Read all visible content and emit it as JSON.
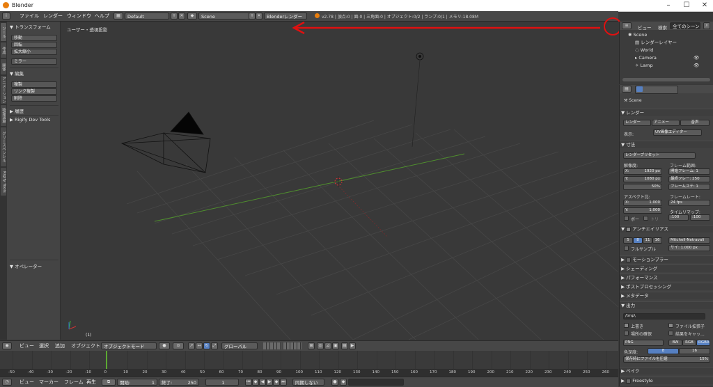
{
  "window": {
    "title": "Blender"
  },
  "top_menu": [
    "ファイル",
    "レンダー",
    "ウィンドウ",
    "ヘルプ"
  ],
  "screen_layout": "Default",
  "scene_name": "Scene",
  "render_engine": "Blenderレンダー",
  "status_text": "v2.78 | 頂点:0 | 面:0 | 三角面:0 | オブジェクト:0/2 | ランプ:0/1 | メモリ:18.08M",
  "viewport": {
    "view_label": "ユーザー・透視投影",
    "frame_label": "(1)"
  },
  "toolshelf_tabs": [
    "ツール",
    "作成",
    "関係",
    "アニメーション",
    "物理演算",
    "グリースペンシル",
    "Rigify Tools"
  ],
  "toolshelf": {
    "transform_header": "トランスフォーム",
    "transform_buttons": [
      "移動",
      "回転",
      "拡大縮小"
    ],
    "mirror_button": "ミラー",
    "edit_header": "編集",
    "edit_buttons": [
      "複製",
      "リンク複製",
      "削除"
    ],
    "history_header": "履歴",
    "rigify_header": "Rigify Dev Tools",
    "operator_header": "オペレーター"
  },
  "outliner": {
    "tabs": [
      "ビュー",
      "検索",
      "全てのシーン"
    ],
    "items": [
      "Scene",
      "レンダーレイヤー",
      "World",
      "Camera",
      "Lamp"
    ]
  },
  "properties": {
    "context": "Scene",
    "render_header": "レンダー",
    "render_buttons": [
      "レンダー",
      "アニメー",
      "音声"
    ],
    "display_label": "表示:",
    "display_value": "UV画像エディター",
    "dimensions_header": "寸法",
    "render_preset": "レンダープリセット",
    "resolution_label": "解像度:",
    "res_x": "X:",
    "res_x_value": "1920 px",
    "res_y": "Y:",
    "res_y_value": "1080 px",
    "res_percent": "50%",
    "frame_range_label": "フレーム範囲:",
    "frame_start": "開始フレーム: 1",
    "frame_end": "最終フレー: 250",
    "frame_step": "フレームステ: 1",
    "aspect_label": "アスペクト比:",
    "aspect_x": "X:",
    "aspect_x_value": "1.000",
    "aspect_y": "Y:",
    "aspect_y_value": "1.000",
    "framerate_label": "フレームレート:",
    "framerate_value": "24 fps",
    "time_remap_label": "タイムリマップ:",
    "remap_old": ":100",
    "remap_new": ":100",
    "border_label": "ボー",
    "crop_label": "トリ",
    "aa_header": "アンチエイリアス",
    "aa_samples": [
      "5",
      "8",
      "11",
      "16"
    ],
    "aa_filter": "Mitchell-Netravali",
    "full_sample": "フルサンプル",
    "size_value": "サイ: 1.000 px",
    "collapsed_panels": [
      "モーションブラー",
      "シェーディング",
      "パフォーマンス",
      "ポストプロセッシング",
      "メタデータ"
    ],
    "output_header": "出力",
    "output_path": "/tmp\\",
    "overwrite": "上書き",
    "file_ext": "ファイル拡張子",
    "placeholders": "場所の確保",
    "cache_result": "結果をキャッ...",
    "format": "PNG",
    "color_modes": [
      "BW",
      "RGB",
      "RGBA"
    ],
    "color_depth_label": "色深度:",
    "color_depth": [
      "8",
      "16"
    ],
    "compression": "保存時にファイルを圧縮",
    "compression_value": "15%",
    "bake_header": "ベイク",
    "freestyle_header": "Freestyle"
  },
  "view3d_header": {
    "menus": [
      "ビュー",
      "選択",
      "追加",
      "オブジェクト"
    ],
    "mode": "オブジェクトモード",
    "orientation": "グローバル"
  },
  "timeline": {
    "ticks": [
      "-50",
      "-40",
      "-30",
      "-20",
      "-10",
      "0",
      "10",
      "20",
      "30",
      "40",
      "50",
      "60",
      "70",
      "80",
      "90",
      "100",
      "110",
      "120",
      "130",
      "140",
      "150",
      "160",
      "170",
      "180",
      "190",
      "200",
      "210",
      "220",
      "230",
      "240",
      "250",
      "260"
    ],
    "menus": [
      "ビュー",
      "マーカー",
      "フレーム",
      "再生"
    ],
    "start_label": "開始:",
    "start_value": "1",
    "end_label": "終了:",
    "end_value": "250",
    "current_frame": "1",
    "sync": "同期しない"
  },
  "colors": {
    "accent": "#5680c2",
    "annotation": "#e01010",
    "x_axis": "#8b2c2c",
    "y_axis": "#5ca832"
  }
}
